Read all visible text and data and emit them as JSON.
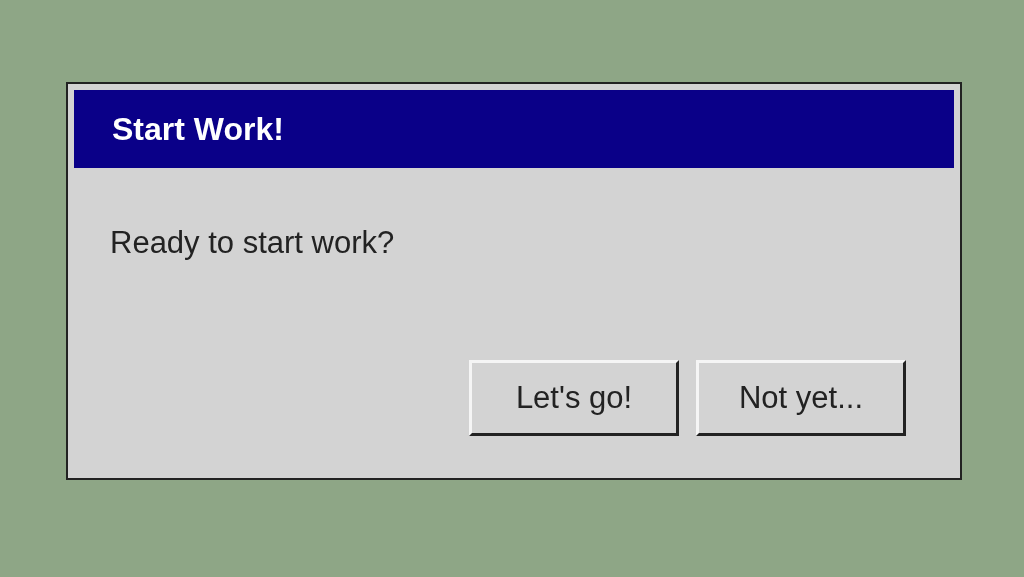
{
  "dialog": {
    "title": "Start Work!",
    "message": "Ready to start work?",
    "buttons": [
      {
        "label": "Let's go!"
      },
      {
        "label": "Not yet..."
      }
    ]
  }
}
